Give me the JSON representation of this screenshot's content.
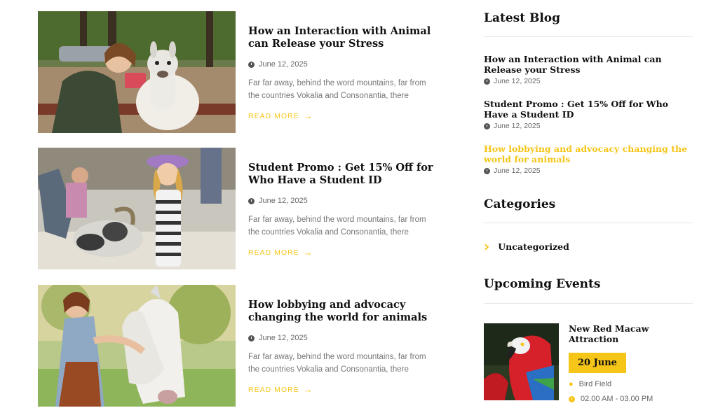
{
  "posts": [
    {
      "title": "How an Interaction with Animal can Release your Stress",
      "date": "June 12, 2025",
      "excerpt": "Far far away, behind the word mountains, far from the countries Vokalia and Consonantia, there",
      "read_more": "READ MORE"
    },
    {
      "title": "Student Promo : Get 15% Off for Who Have a Student ID",
      "date": "June 12, 2025",
      "excerpt": "Far far away, behind the word mountains, far from the countries Vokalia and Consonantia, there",
      "read_more": "READ MORE"
    },
    {
      "title": "How lobbying and advocacy changing the world for animals",
      "date": "June 12, 2025",
      "excerpt": "Far far away, behind the word mountains, far from the countries Vokalia and Consonantia, there",
      "read_more": "READ MORE"
    }
  ],
  "sidebar": {
    "latest_blog": {
      "title": "Latest Blog",
      "items": [
        {
          "title": "How an Interaction with Animal can Release your Stress",
          "date": "June 12, 2025"
        },
        {
          "title": "Student Promo : Get 15% Off for Who Have a Student ID",
          "date": "June 12, 2025"
        },
        {
          "title": "How lobbying and advocacy changing the world for animals",
          "date": "June 12, 2025"
        }
      ]
    },
    "categories": {
      "title": "Categories",
      "items": [
        {
          "label": "Uncategorized"
        }
      ]
    },
    "upcoming_events": {
      "title": "Upcoming Events",
      "event": {
        "title": "New Red Macaw Attraction",
        "date": "20 June",
        "location": "Bird Field",
        "time": "02.00 AM - 03.00 PM"
      }
    }
  },
  "colors": {
    "accent": "#f5c518",
    "heading": "#111111",
    "muted": "#777777"
  },
  "icons": {
    "date": "clock-icon",
    "readmore": "arrow-right-icon",
    "category": "chevron-right-icon",
    "location": "map-pin-icon",
    "time": "clock-icon"
  }
}
